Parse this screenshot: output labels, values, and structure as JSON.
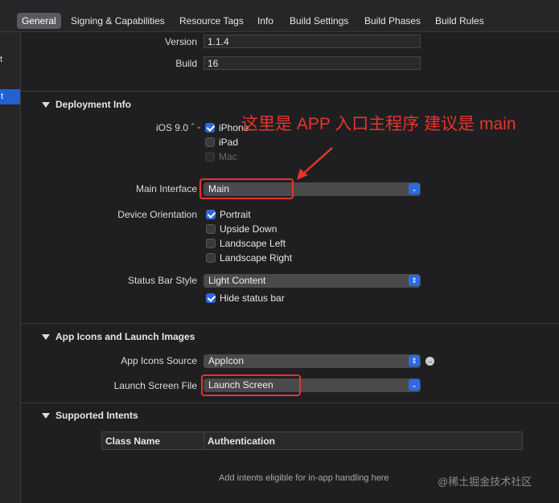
{
  "tabs": [
    "General",
    "Signing & Capabilities",
    "Resource Tags",
    "Info",
    "Build Settings",
    "Build Phases",
    "Build Rules"
  ],
  "sidebar": {
    "frag1": "t",
    "frag2": "t"
  },
  "identity": {
    "version_label": "Version",
    "version_value": "1.1.4",
    "build_label": "Build",
    "build_value": "16"
  },
  "deployment": {
    "title": "Deployment Info",
    "ios_label": "iOS 9.0",
    "devices": [
      {
        "label": "iPhone",
        "checked": true,
        "disabled": false
      },
      {
        "label": "iPad",
        "checked": false,
        "disabled": false
      },
      {
        "label": "Mac",
        "checked": false,
        "disabled": true
      }
    ],
    "main_interface_label": "Main Interface",
    "main_interface_value": "Main",
    "orientation_label": "Device Orientation",
    "orientations": [
      {
        "label": "Portrait",
        "checked": true
      },
      {
        "label": "Upside Down",
        "checked": false
      },
      {
        "label": "Landscape Left",
        "checked": false
      },
      {
        "label": "Landscape Right",
        "checked": false
      }
    ],
    "status_bar_label": "Status Bar Style",
    "status_bar_value": "Light Content",
    "hide_status_bar": "Hide status bar"
  },
  "app_icons": {
    "title": "App Icons and Launch Images",
    "source_label": "App Icons Source",
    "source_value": "AppIcon",
    "launch_label": "Launch Screen File",
    "launch_value": "Launch Screen"
  },
  "intents": {
    "title": "Supported Intents",
    "col_class": "Class Name",
    "col_auth": "Authentication",
    "placeholder": "Add intents eligible for in-app handling here"
  },
  "annotation": "这里是 APP 入口主程序 建议是 main",
  "watermark": "@稀土掘金技术社区",
  "colors": {
    "accent": "#2d6ae0",
    "annotation": "#e8342a",
    "background": "#1f1f21"
  }
}
